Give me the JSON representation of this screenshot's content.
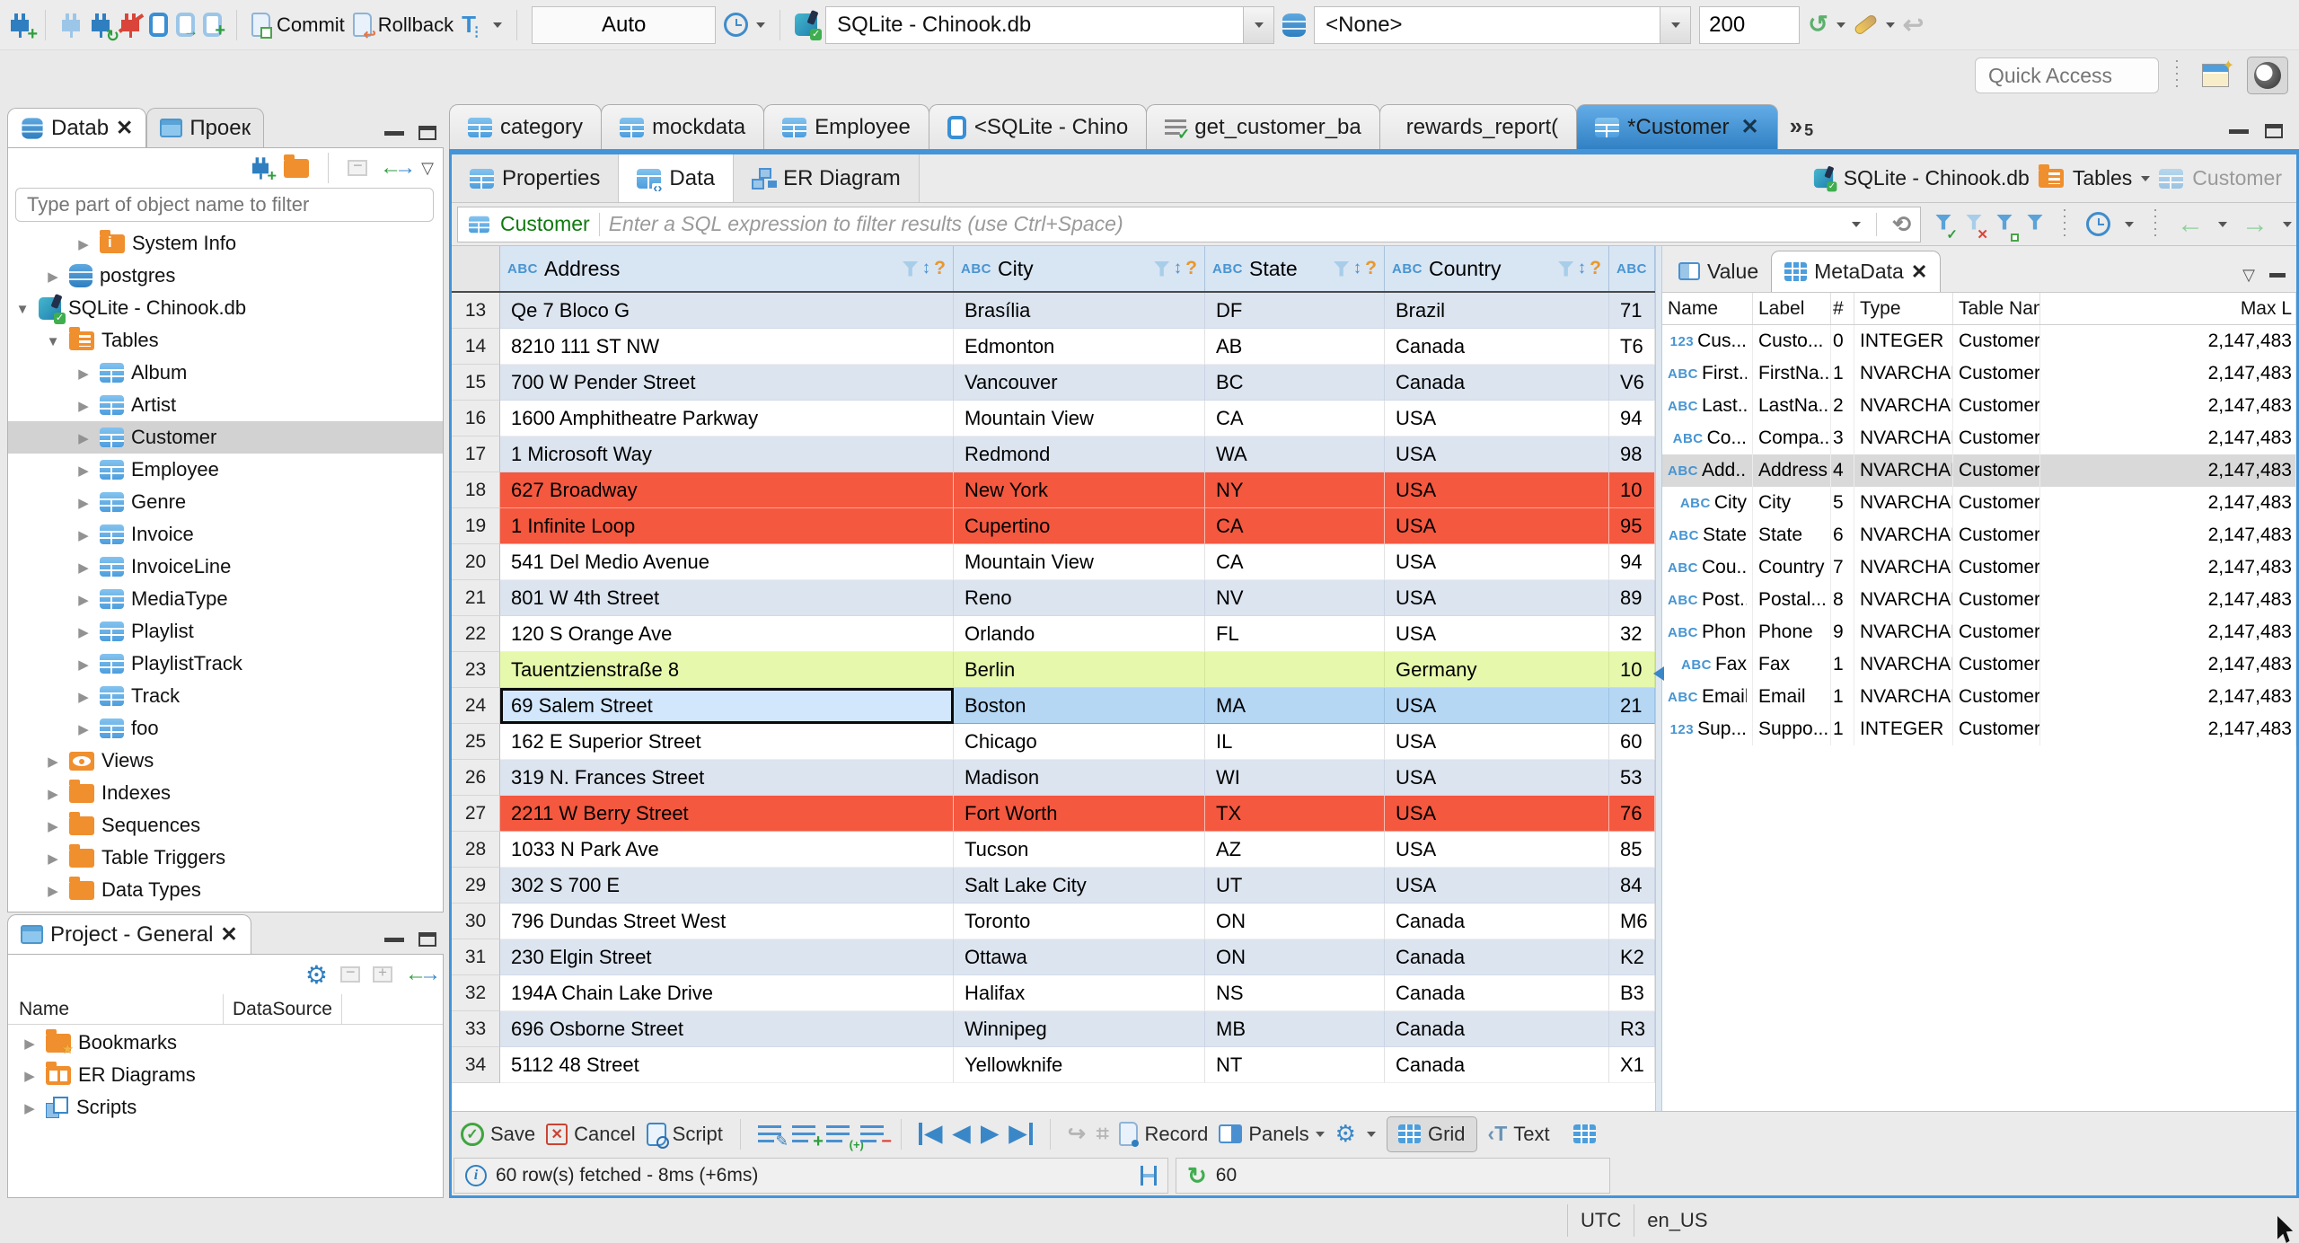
{
  "top_toolbar": {
    "commit_label": "Commit",
    "rollback_label": "Rollback",
    "auto_commit_label": "Auto",
    "connection_value": "SQLite - Chinook.db",
    "schema_value": "<None>",
    "fetch_size_value": "200",
    "quick_access_placeholder": "Quick Access"
  },
  "editor_tabs": {
    "tabs": [
      {
        "label": "category",
        "icon": "table"
      },
      {
        "label": "mockdata",
        "icon": "table"
      },
      {
        "label": "Employee",
        "icon": "table"
      },
      {
        "label": "<SQLite - Chino",
        "icon": "sql"
      },
      {
        "label": "get_customer_ba",
        "icon": "sql-check"
      },
      {
        "label": "rewards_report(",
        "icon": "function"
      },
      {
        "label": "*Customer",
        "icon": "table",
        "active": true,
        "closable": true
      }
    ],
    "overflow_count": "5"
  },
  "navigator": {
    "database_tab_label": "Datab",
    "project_tab_label": "Проек",
    "filter_placeholder": "Type part of object name to filter",
    "tree": [
      {
        "label": "System Info",
        "icon": "folder-info",
        "indent": 2,
        "expander": "collapsed"
      },
      {
        "label": "postgres",
        "icon": "db",
        "indent": 1,
        "expander": "collapsed"
      },
      {
        "label": "SQLite - Chinook.db",
        "icon": "sqlite",
        "indent": 0,
        "expander": "expanded"
      },
      {
        "label": "Tables",
        "icon": "folder-table",
        "indent": 1,
        "expander": "expanded"
      },
      {
        "label": "Album",
        "icon": "table",
        "indent": 2,
        "expander": "collapsed"
      },
      {
        "label": "Artist",
        "icon": "table",
        "indent": 2,
        "expander": "collapsed"
      },
      {
        "label": "Customer",
        "icon": "table",
        "indent": 2,
        "expander": "collapsed",
        "selected": true
      },
      {
        "label": "Employee",
        "icon": "table",
        "indent": 2,
        "expander": "collapsed"
      },
      {
        "label": "Genre",
        "icon": "table",
        "indent": 2,
        "expander": "collapsed"
      },
      {
        "label": "Invoice",
        "icon": "table",
        "indent": 2,
        "expander": "collapsed"
      },
      {
        "label": "InvoiceLine",
        "icon": "table",
        "indent": 2,
        "expander": "collapsed"
      },
      {
        "label": "MediaType",
        "icon": "table",
        "indent": 2,
        "expander": "collapsed"
      },
      {
        "label": "Playlist",
        "icon": "table",
        "indent": 2,
        "expander": "collapsed"
      },
      {
        "label": "PlaylistTrack",
        "icon": "table",
        "indent": 2,
        "expander": "collapsed"
      },
      {
        "label": "Track",
        "icon": "table",
        "indent": 2,
        "expander": "collapsed"
      },
      {
        "label": "foo",
        "icon": "table",
        "indent": 2,
        "expander": "collapsed"
      },
      {
        "label": "Views",
        "icon": "views",
        "indent": 1,
        "expander": "collapsed"
      },
      {
        "label": "Indexes",
        "icon": "folder",
        "indent": 1,
        "expander": "collapsed"
      },
      {
        "label": "Sequences",
        "icon": "folder",
        "indent": 1,
        "expander": "collapsed"
      },
      {
        "label": "Table Triggers",
        "icon": "folder",
        "indent": 1,
        "expander": "collapsed"
      },
      {
        "label": "Data Types",
        "icon": "folder",
        "indent": 1,
        "expander": "collapsed"
      }
    ]
  },
  "project_panel": {
    "title": "Project - General",
    "columns": [
      {
        "label": "Name"
      },
      {
        "label": "DataSource"
      }
    ],
    "items": [
      {
        "label": "Bookmarks",
        "icon": "folder-bookmark",
        "expander": "collapsed"
      },
      {
        "label": "ER Diagrams",
        "icon": "folder-er",
        "expander": "collapsed"
      },
      {
        "label": "Scripts",
        "icon": "scripts",
        "expander": "collapsed"
      }
    ]
  },
  "editor": {
    "result_tabs": [
      {
        "label": "Properties"
      },
      {
        "label": "Data"
      },
      {
        "label": "ER Diagram"
      }
    ],
    "breadcrumb": {
      "connection": "SQLite - Chinook.db",
      "folder": "Tables",
      "table": "Customer"
    },
    "filter": {
      "table_label": "Customer",
      "placeholder": "Enter a SQL expression to filter results (use Ctrl+Space)"
    },
    "grid": {
      "columns": [
        {
          "type": "ABC",
          "name": "Address"
        },
        {
          "type": "ABC",
          "name": "City"
        },
        {
          "type": "ABC",
          "name": "State"
        },
        {
          "type": "ABC",
          "name": "Country"
        },
        {
          "type": "ABC",
          "name": ""
        }
      ],
      "rows": [
        {
          "num": "13",
          "cells": [
            "Qe 7 Bloco G",
            "Brasília",
            "DF",
            "Brazil",
            "71"
          ],
          "variant": "odd"
        },
        {
          "num": "14",
          "cells": [
            "8210 111 ST NW",
            "Edmonton",
            "AB",
            "Canada",
            "T6"
          ],
          "variant": "even"
        },
        {
          "num": "15",
          "cells": [
            "700 W Pender Street",
            "Vancouver",
            "BC",
            "Canada",
            "V6"
          ],
          "variant": "odd"
        },
        {
          "num": "16",
          "cells": [
            "1600 Amphitheatre Parkway",
            "Mountain View",
            "CA",
            "USA",
            "94"
          ],
          "variant": "even"
        },
        {
          "num": "17",
          "cells": [
            "1 Microsoft Way",
            "Redmond",
            "WA",
            "USA",
            "98"
          ],
          "variant": "odd"
        },
        {
          "num": "18",
          "cells": [
            "627 Broadway",
            "New York",
            "NY",
            "USA",
            "10"
          ],
          "variant": "error"
        },
        {
          "num": "19",
          "cells": [
            "1 Infinite Loop",
            "Cupertino",
            "CA",
            "USA",
            "95"
          ],
          "variant": "error"
        },
        {
          "num": "20",
          "cells": [
            "541 Del Medio Avenue",
            "Mountain View",
            "CA",
            "USA",
            "94"
          ],
          "variant": "even"
        },
        {
          "num": "21",
          "cells": [
            "801 W 4th Street",
            "Reno",
            "NV",
            "USA",
            "89"
          ],
          "variant": "odd"
        },
        {
          "num": "22",
          "cells": [
            "120 S Orange Ave",
            "Orlando",
            "FL",
            "USA",
            "32"
          ],
          "variant": "even"
        },
        {
          "num": "23",
          "cells": [
            "Tauentzienstraße 8",
            "Berlin",
            "",
            "Germany",
            "10"
          ],
          "variant": "new"
        },
        {
          "num": "24",
          "cells": [
            "69 Salem Street",
            "Boston",
            "MA",
            "USA",
            "21"
          ],
          "variant": "selected"
        },
        {
          "num": "25",
          "cells": [
            "162 E Superior Street",
            "Chicago",
            "IL",
            "USA",
            "60"
          ],
          "variant": "even"
        },
        {
          "num": "26",
          "cells": [
            "319 N. Frances Street",
            "Madison",
            "WI",
            "USA",
            "53"
          ],
          "variant": "odd"
        },
        {
          "num": "27",
          "cells": [
            "2211 W Berry Street",
            "Fort Worth",
            "TX",
            "USA",
            "76"
          ],
          "variant": "error"
        },
        {
          "num": "28",
          "cells": [
            "1033 N Park Ave",
            "Tucson",
            "AZ",
            "USA",
            "85"
          ],
          "variant": "even"
        },
        {
          "num": "29",
          "cells": [
            "302 S 700 E",
            "Salt Lake City",
            "UT",
            "USA",
            "84"
          ],
          "variant": "odd"
        },
        {
          "num": "30",
          "cells": [
            "796 Dundas Street West",
            "Toronto",
            "ON",
            "Canada",
            "M6"
          ],
          "variant": "even"
        },
        {
          "num": "31",
          "cells": [
            "230 Elgin Street",
            "Ottawa",
            "ON",
            "Canada",
            "K2"
          ],
          "variant": "odd"
        },
        {
          "num": "32",
          "cells": [
            "194A Chain Lake Drive",
            "Halifax",
            "NS",
            "Canada",
            "B3"
          ],
          "variant": "even"
        },
        {
          "num": "33",
          "cells": [
            "696 Osborne Street",
            "Winnipeg",
            "MB",
            "Canada",
            "R3"
          ],
          "variant": "odd"
        },
        {
          "num": "34",
          "cells": [
            "5112 48 Street",
            "Yellowknife",
            "NT",
            "Canada",
            "X1"
          ],
          "variant": "even"
        }
      ]
    },
    "bottom_toolbar": {
      "save": "Save",
      "cancel": "Cancel",
      "script": "Script",
      "record": "Record",
      "panels": "Panels",
      "grid": "Grid",
      "text": "Text"
    },
    "status": {
      "message": "60 row(s) fetched - 8ms (+6ms)",
      "auto_refresh_value": "60"
    }
  },
  "metadata_panel": {
    "value_tab_label": "Value",
    "metadata_tab_label": "MetaData",
    "columns": [
      {
        "label": "Name"
      },
      {
        "label": "Label"
      },
      {
        "label": "#"
      },
      {
        "label": "Type"
      },
      {
        "label": "Table Name"
      },
      {
        "label": "Max L"
      }
    ],
    "rows": [
      {
        "icon": "123",
        "name": "Cus...",
        "label": "Custo...",
        "num": "0",
        "type": "INTEGER",
        "table": "Customer",
        "max": "2,147,483"
      },
      {
        "icon": "ABC",
        "name": "First...",
        "label": "FirstNa...",
        "num": "1",
        "type": "NVARCHAR",
        "table": "Customer",
        "max": "2,147,483"
      },
      {
        "icon": "ABC",
        "name": "Last...",
        "label": "LastNa...",
        "num": "2",
        "type": "NVARCHAR",
        "table": "Customer",
        "max": "2,147,483"
      },
      {
        "icon": "ABC",
        "name": "Co...",
        "label": "Compa...",
        "num": "3",
        "type": "NVARCHAR",
        "table": "Customer",
        "max": "2,147,483"
      },
      {
        "icon": "ABC",
        "name": "Add...",
        "label": "Address",
        "num": "4",
        "type": "NVARCHAR",
        "table": "Customer",
        "max": "2,147,483",
        "selected": true
      },
      {
        "icon": "ABC",
        "name": "City",
        "label": "City",
        "num": "5",
        "type": "NVARCHAR",
        "table": "Customer",
        "max": "2,147,483"
      },
      {
        "icon": "ABC",
        "name": "State",
        "label": "State",
        "num": "6",
        "type": "NVARCHAR",
        "table": "Customer",
        "max": "2,147,483"
      },
      {
        "icon": "ABC",
        "name": "Cou...",
        "label": "Country",
        "num": "7",
        "type": "NVARCHAR",
        "table": "Customer",
        "max": "2,147,483"
      },
      {
        "icon": "ABC",
        "name": "Post...",
        "label": "Postal...",
        "num": "8",
        "type": "NVARCHAR",
        "table": "Customer",
        "max": "2,147,483"
      },
      {
        "icon": "ABC",
        "name": "Phone",
        "label": "Phone",
        "num": "9",
        "type": "NVARCHAR",
        "table": "Customer",
        "max": "2,147,483"
      },
      {
        "icon": "ABC",
        "name": "Fax",
        "label": "Fax",
        "num": "1",
        "type": "NVARCHAR",
        "table": "Customer",
        "max": "2,147,483"
      },
      {
        "icon": "ABC",
        "name": "Email",
        "label": "Email",
        "num": "1",
        "type": "NVARCHAR",
        "table": "Customer",
        "max": "2,147,483"
      },
      {
        "icon": "123",
        "name": "Sup...",
        "label": "Suppo...",
        "num": "1",
        "type": "INTEGER",
        "table": "Customer",
        "max": "2,147,483"
      }
    ]
  },
  "window_status": {
    "timezone": "UTC",
    "locale": "en_US"
  }
}
